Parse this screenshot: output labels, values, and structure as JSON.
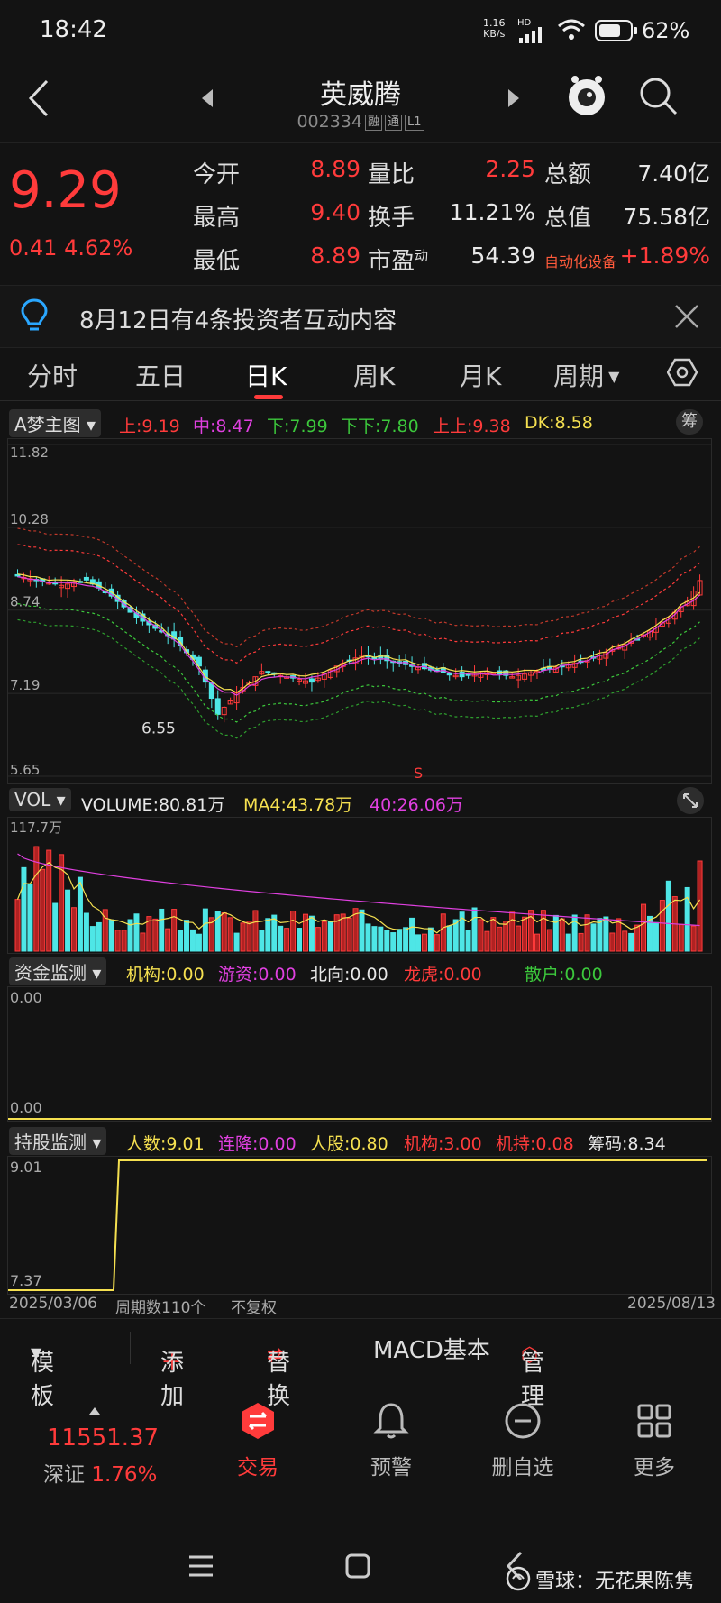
{
  "status": {
    "time": "18:42",
    "net_speed": "1.16",
    "net_unit": "KB/s",
    "hd": "HD",
    "battery": "62%"
  },
  "header": {
    "title": "英威腾",
    "code": "002334",
    "tags": [
      "融",
      "通",
      "L1"
    ]
  },
  "quote": {
    "price": "9.29",
    "change": "0.41",
    "change_pct": "4.62%",
    "rows": [
      [
        {
          "label": "今开",
          "value": "8.89"
        },
        {
          "label": "量比",
          "value": "2.25"
        },
        {
          "label": "总额",
          "value": "7.40亿"
        }
      ],
      [
        {
          "label": "最高",
          "value": "9.40"
        },
        {
          "label": "换手",
          "value": "11.21%"
        },
        {
          "label": "总值",
          "value": "75.58亿"
        }
      ],
      [
        {
          "label": "最低",
          "value": "8.89"
        },
        {
          "label": "市盈",
          "sup": "动",
          "value": "54.39"
        },
        {
          "label": "自动化设备",
          "value": "+1.89%"
        }
      ]
    ]
  },
  "notice": {
    "text": "8月12日有4条投资者互动内容"
  },
  "tabs": [
    "分时",
    "五日",
    "日K",
    "周K",
    "月K",
    "周期"
  ],
  "main_indicator": {
    "name": "A梦主图",
    "items": [
      {
        "label": "上:9.19",
        "color": "#ff3b3b"
      },
      {
        "label": "中:8.47",
        "color": "#e040e0"
      },
      {
        "label": "下:7.99",
        "color": "#3cc83c"
      },
      {
        "label": "下下:7.80",
        "color": "#3cc83c"
      },
      {
        "label": "上上:9.38",
        "color": "#ff3b3b"
      },
      {
        "label": "DK:8.58",
        "color": "#f5e050"
      }
    ],
    "badge": "筹",
    "y_labels": [
      "11.82",
      "10.28",
      "8.74",
      "7.19",
      "5.65"
    ],
    "min_label": "6.55",
    "s_mark": "S"
  },
  "vol_indicator": {
    "name": "VOL",
    "items": [
      {
        "label": "VOLUME:80.81万",
        "color": "#e8e8e8"
      },
      {
        "label": "MA4:43.78万",
        "color": "#f5e050"
      },
      {
        "label": "40:26.06万",
        "color": "#e040e0"
      }
    ],
    "y_label": "117.7万"
  },
  "fund_indicator": {
    "name": "资金监测",
    "items": [
      {
        "label": "机构:0.00",
        "color": "#f5e050"
      },
      {
        "label": "游资:0.00",
        "color": "#e040e0"
      },
      {
        "label": "北向:0.00",
        "color": "#e8e8e8"
      },
      {
        "label": "龙虎:0.00",
        "color": "#ff3b3b"
      },
      {
        "label": "散户:0.00",
        "color": "#3cc83c"
      }
    ],
    "y_top": "0.00",
    "y_bottom": "0.00"
  },
  "hold_indicator": {
    "name": "持股监测",
    "items": [
      {
        "label": "人数:9.01",
        "color": "#f5e050"
      },
      {
        "label": "连降:0.00",
        "color": "#e040e0"
      },
      {
        "label": "人股:0.80",
        "color": "#f5e050"
      },
      {
        "label": "机构:3.00",
        "color": "#ff3b3b"
      },
      {
        "label": "机持:0.08",
        "color": "#ff3b3b"
      },
      {
        "label": "筹码:8.34",
        "color": "#e8e8e8"
      }
    ],
    "y_top": "9.01",
    "y_bottom": "7.37"
  },
  "axis": {
    "start": "2025/03/06",
    "periods": "周期数110个",
    "adjust": "不复权",
    "end": "2025/08/13"
  },
  "tools": {
    "template": "模板",
    "add": "添加",
    "replace": "替换",
    "macd": "MACD基本",
    "manage": "管理"
  },
  "nav": {
    "index_value": "11551.37",
    "index_name": "深证",
    "index_pct": "1.76%",
    "items": [
      "交易",
      "预警",
      "删自选",
      "更多"
    ]
  },
  "watermark": "雪球：无花果陈隽",
  "colors": {
    "up": "#ff3b3b",
    "down": "#4ee6e6",
    "bg": "#131313"
  }
}
